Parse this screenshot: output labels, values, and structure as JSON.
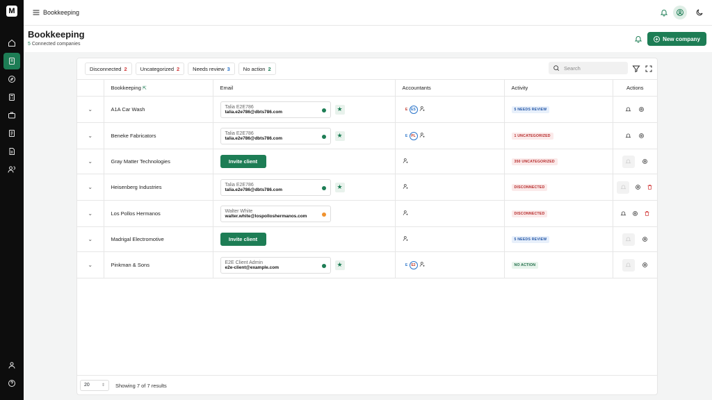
{
  "header": {
    "breadcrumb": "Bookkeeping"
  },
  "page": {
    "title": "Bookkeeping",
    "connected_count": "5",
    "connected_label": "Connected companies",
    "new_company_label": "New company"
  },
  "filters": [
    {
      "label": "Disconnected",
      "count": "2"
    },
    {
      "label": "Uncategorized",
      "count": "2"
    },
    {
      "label": "Needs review",
      "count": "3"
    },
    {
      "label": "No action",
      "count": "2"
    }
  ],
  "search": {
    "placeholder": "Search"
  },
  "table": {
    "columns": {
      "bookkeeping": "Bookkeeping",
      "email": "Email",
      "accountants": "Accountants",
      "activity": "Activity",
      "actions": "Actions"
    },
    "rows": [
      {
        "name": "A1A Car Wash",
        "email_name": "Talia E2E786",
        "email": "talia.e2e786@dbts786.com",
        "accountants": [
          "E",
          "ES"
        ],
        "activity": "5 NEEDS REVIEW"
      },
      {
        "name": "Beneke Fabricators",
        "email_name": "Talia E2E786",
        "email": "talia.e2e786@dbts786.com",
        "accountants": [
          "E",
          "PL"
        ],
        "activity": "1 UNCATEGORIZED"
      },
      {
        "name": "Gray Matter Technologies",
        "invite_label": "Invite client",
        "activity": "350 UNCATEGORIZED"
      },
      {
        "name": "Heisenberg Industries",
        "email_name": "Talia E2E786",
        "email": "talia.e2e786@dbts786.com",
        "activity": "DISCONNECTED"
      },
      {
        "name": "Los Pollos Hermanos",
        "email_name": "Walter White",
        "email": "walter.white@lospolloshermanos.com",
        "activity": "DISCONNECTED"
      },
      {
        "name": "Madrigal Electromotive",
        "invite_label": "Invite client",
        "activity": "5 NEEDS REVIEW"
      },
      {
        "name": "Pinkman & Sons",
        "email_name": "E2E Client Admin",
        "email": "e2e-client@example.com",
        "accountants": [
          "E",
          "E2"
        ],
        "activity": "NO ACTION"
      }
    ]
  },
  "footer": {
    "page_size": "20",
    "showing": "Showing 7 of 7 results"
  },
  "colors": {
    "brand": "#1d7d55",
    "danger": "#d23b3b",
    "warning": "#f0922e"
  }
}
